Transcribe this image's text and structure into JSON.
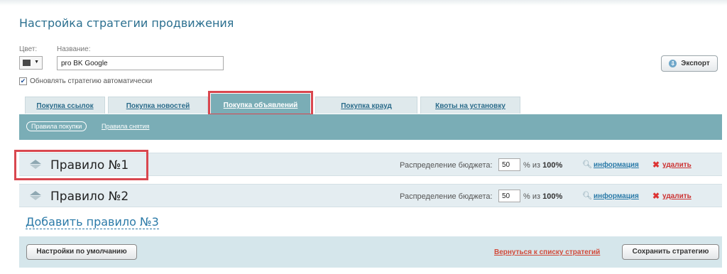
{
  "page": {
    "title": "Настройка стратегии продвижения"
  },
  "form": {
    "color_label": "Цвет:",
    "color_value": "#4a4a4a",
    "name_label": "Название:",
    "name_value": "pro BK Google",
    "auto_update_label": "Обновлять стратегию автоматически",
    "auto_update_checked": true,
    "export_label": "Экспорт"
  },
  "tabs": [
    {
      "label": "Покупка ссылок",
      "active": false
    },
    {
      "label": "Покупка новостей",
      "active": false
    },
    {
      "label": "Покупка объявлений",
      "active": true
    },
    {
      "label": "Покупка крауд",
      "active": false
    },
    {
      "label": "Квоты на установку",
      "active": false
    }
  ],
  "subtabs": {
    "active": "Правила покупки",
    "other": "Правила снятия"
  },
  "rules": [
    {
      "title": "Правило №1",
      "budget_label": "Распределение бюджета:",
      "budget_value": "50",
      "budget_suffix": "% из ",
      "budget_total": "100%",
      "info_label": "информация",
      "delete_label": "удалить"
    },
    {
      "title": "Правило №2",
      "budget_label": "Распределение бюджета:",
      "budget_value": "50",
      "budget_suffix": "% из ",
      "budget_total": "100%",
      "info_label": "информация",
      "delete_label": "удалить"
    }
  ],
  "add_rule_label": "Добавить правило №3",
  "footer": {
    "defaults_button": "Настройки по умолчанию",
    "back_link": "Вернуться к списку стратегий",
    "save_button": "Сохранить стратегию"
  },
  "colors": {
    "accent": "#7aadb6",
    "highlight": "#d9474f",
    "link": "#2a7aa8"
  }
}
